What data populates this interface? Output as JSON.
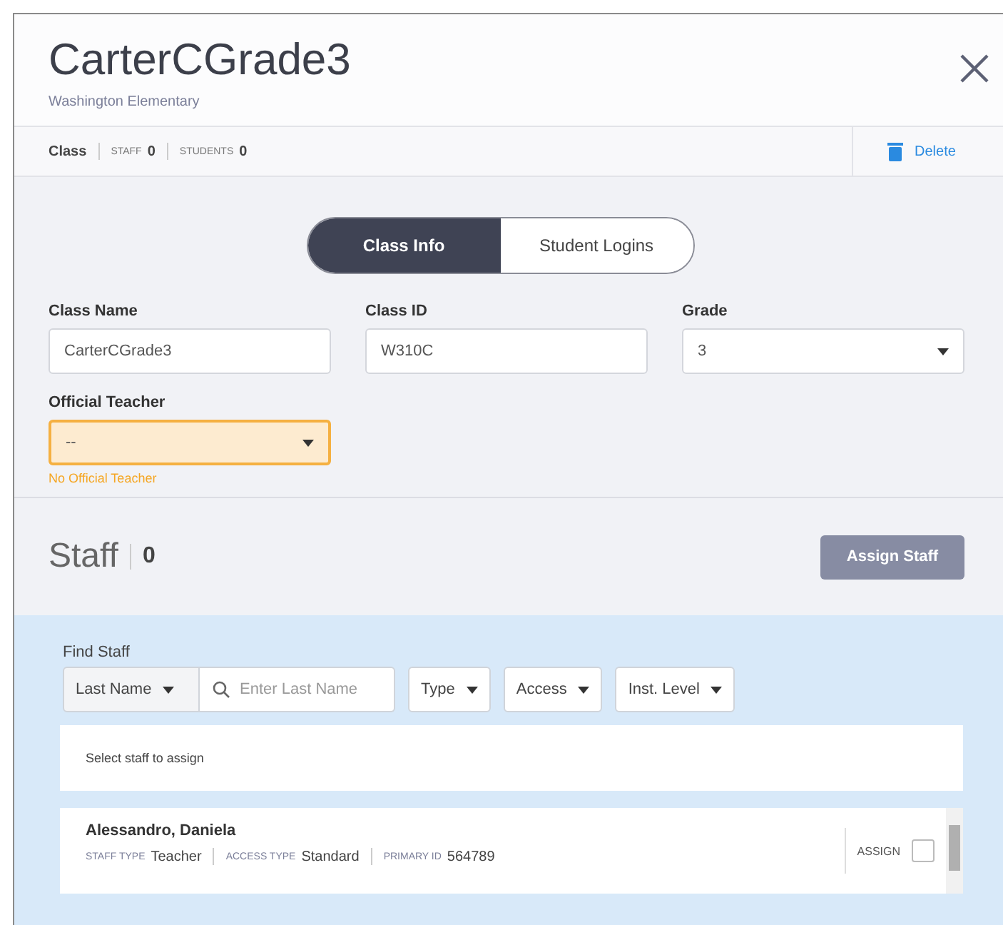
{
  "header": {
    "title": "CarterCGrade3",
    "subtitle": "Washington Elementary"
  },
  "info_bar": {
    "label": "Class",
    "stats": [
      {
        "label": "STAFF",
        "value": "0"
      },
      {
        "label": "STUDENTS",
        "value": "0"
      }
    ],
    "delete": "Delete"
  },
  "tabs": [
    {
      "label": "Class Info",
      "selected": true
    },
    {
      "label": "Student Logins",
      "selected": false
    }
  ],
  "fields": [
    {
      "label": "Class Name",
      "value": "CarterCGrade3",
      "kind": "text"
    },
    {
      "label": "Class ID",
      "value": "W310C",
      "kind": "text"
    },
    {
      "label": "Grade",
      "value": "3",
      "kind": "select"
    },
    {
      "label": "Official Teacher",
      "value": "--",
      "kind": "select",
      "warning": "No Official Teacher"
    }
  ],
  "staff": {
    "title": "Staff",
    "count": "0",
    "button": "Assign Staff"
  },
  "find": {
    "label": "Find Staff",
    "search_by": "Last Name",
    "placeholder": "Enter Last Name",
    "filters": [
      "Type",
      "Access",
      "Inst. Level"
    ],
    "hint": "Select staff to assign"
  },
  "results": [
    {
      "name": "Alessandro, Daniela",
      "meta": [
        {
          "label": "STAFF TYPE",
          "value": "Teacher"
        },
        {
          "label": "ACCESS TYPE",
          "value": "Standard"
        },
        {
          "label": "PRIMARY ID",
          "value": "564789"
        }
      ],
      "assign_label": "ASSIGN",
      "checked": false
    }
  ]
}
